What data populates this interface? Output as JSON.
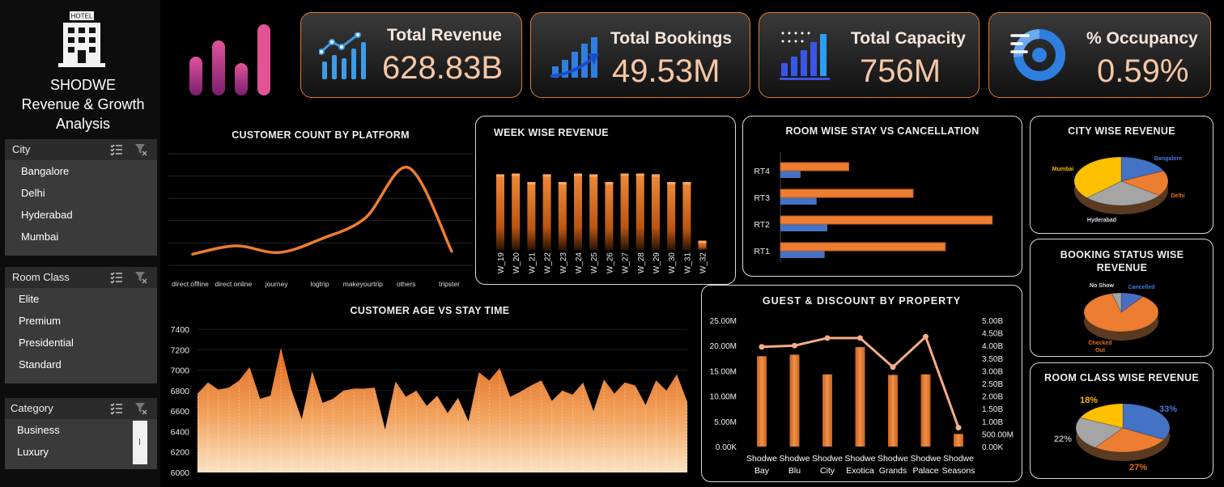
{
  "app": {
    "title_line1": "SHODWE",
    "title_line2": "Revenue & Growth",
    "title_line3": "Analysis",
    "logo_text": "HOTEL"
  },
  "slicers": [
    {
      "title": "City",
      "items": [
        "Bangalore",
        "Delhi",
        "Hyderabad",
        "Mumbai"
      ]
    },
    {
      "title": "Room Class",
      "items": [
        "Elite",
        "Premium",
        "Presidential",
        "Standard"
      ]
    },
    {
      "title": "Category",
      "items": [
        "Business",
        "Luxury"
      ]
    }
  ],
  "kpis": [
    {
      "label": "Total Revenue",
      "value": "628.83B",
      "icon": "rising-bar-chart-icon"
    },
    {
      "label": "Total Bookings",
      "value": "49.53M",
      "icon": "growth-arrow-chart-icon"
    },
    {
      "label": "Total Capacity",
      "value": "756M",
      "icon": "bar-chart-icon"
    },
    {
      "label": "% Occupancy",
      "value": "0.59%",
      "icon": "donut-progress-icon"
    }
  ],
  "colors": {
    "accent": "#ed7d31",
    "blue": "#4472c4",
    "gray": "#a5a5a5",
    "yellow": "#ffc000",
    "kpi_value": "#f6c7a6",
    "border": "#d9d9d9"
  },
  "chart_data": [
    {
      "id": "platform",
      "type": "line",
      "title": "CUSTOMER COUNT BY PLATFORM",
      "categories": [
        "direct offline",
        "direct online",
        "journey",
        "logtrip",
        "makeyourtrip",
        "others",
        "tripster"
      ],
      "values": [
        2,
        3.5,
        2.3,
        4.8,
        8.5,
        17.5,
        2.5
      ],
      "ylim": [
        0,
        20
      ]
    },
    {
      "id": "week",
      "type": "bar",
      "title": "WEEK WISE REVENUE",
      "categories": [
        "W_19",
        "W_20",
        "W_21",
        "W_22",
        "W_23",
        "W_24",
        "W_25",
        "W_26",
        "W_27",
        "W_28",
        "W_29",
        "W_30",
        "W_31",
        "W_32"
      ],
      "values": [
        49,
        49.5,
        44,
        49,
        44,
        49.5,
        49,
        44,
        49.5,
        49.5,
        49,
        44,
        44,
        6
      ],
      "ylim": [
        0,
        55
      ]
    },
    {
      "id": "room",
      "type": "bar",
      "orientation": "horizontal",
      "title": "ROOM WISE STAY VS CANCELLATION",
      "categories": [
        "RT1",
        "RT2",
        "RT3",
        "RT4"
      ],
      "series": [
        {
          "values": [
            33,
            35,
            27,
            15
          ]
        },
        {
          "values": [
            123,
            158,
            99,
            51
          ]
        }
      ],
      "xlim": [
        0,
        160
      ]
    },
    {
      "id": "city",
      "type": "pie",
      "title": "CITY WISE REVENUE",
      "labels": [
        "Bangalore",
        "Delhi",
        "Hyderabad",
        "Mumbai"
      ],
      "values": [
        18,
        17,
        28,
        37
      ]
    },
    {
      "id": "status",
      "type": "pie",
      "title": "BOOKING STATUS WISE REVENUE",
      "labels": [
        "Cancelled",
        "Checked Out",
        "No Show"
      ],
      "values": [
        10,
        86,
        4
      ]
    },
    {
      "id": "roomclass",
      "type": "pie",
      "title": "ROOM CLASS WISE REVENUE",
      "labels": [
        "33%",
        "27%",
        "22%",
        "18%"
      ],
      "values": [
        33,
        27,
        22,
        18
      ]
    },
    {
      "id": "age",
      "type": "area",
      "title": "CUSTOMER AGE VS STAY TIME",
      "yticks": [
        "7400",
        "7200",
        "7000",
        "6800",
        "6600",
        "6400",
        "6200",
        "6000"
      ],
      "ylim": [
        6000,
        7400
      ],
      "values": [
        6770,
        6880,
        6810,
        6830,
        6900,
        7030,
        6720,
        6750,
        7220,
        6810,
        6520,
        6990,
        6680,
        6720,
        6800,
        6820,
        6820,
        6830,
        6420,
        6890,
        6740,
        6800,
        6650,
        6750,
        6580,
        6730,
        6500,
        6980,
        6900,
        7020,
        6740,
        6790,
        6850,
        6900,
        6700,
        6800,
        6760,
        6880,
        6600,
        6910,
        6770,
        6880,
        6850,
        6660,
        6900,
        6800,
        6960,
        6690
      ]
    },
    {
      "id": "property",
      "type": "bar",
      "title": "GUEST & DISCOUNT BY PROPERTY",
      "categories": [
        [
          "Shodwe",
          "Bay"
        ],
        [
          "Shodwe",
          "Blu"
        ],
        [
          "Shodwe",
          "City"
        ],
        [
          "Shodwe",
          "Exotica"
        ],
        [
          "Shodwe",
          "Grands"
        ],
        [
          "Shodwe",
          "Palace"
        ],
        [
          "Shodwe",
          "Seasons"
        ]
      ],
      "series": [
        {
          "values": [
            17.9,
            18.2,
            14.3,
            19.7,
            14.2,
            14.3,
            2.5
          ]
        },
        {
          "type": "line",
          "values": [
            3.95,
            4.0,
            4.3,
            4.3,
            3.15,
            4.35,
            0.75
          ]
        }
      ],
      "yticks_left": [
        "25.00M",
        "20.00M",
        "15.00M",
        "10.00M",
        "5.00M",
        "0.00K"
      ],
      "yticks_right": [
        "5.00B",
        "4.50B",
        "4.00B",
        "3.50B",
        "3.00B",
        "2.50B",
        "2.00B",
        "1.50B",
        "1.00B",
        "500.00M",
        "0.00K"
      ],
      "ylim_left": [
        0,
        25
      ],
      "ylim_right": [
        0,
        5
      ]
    }
  ]
}
